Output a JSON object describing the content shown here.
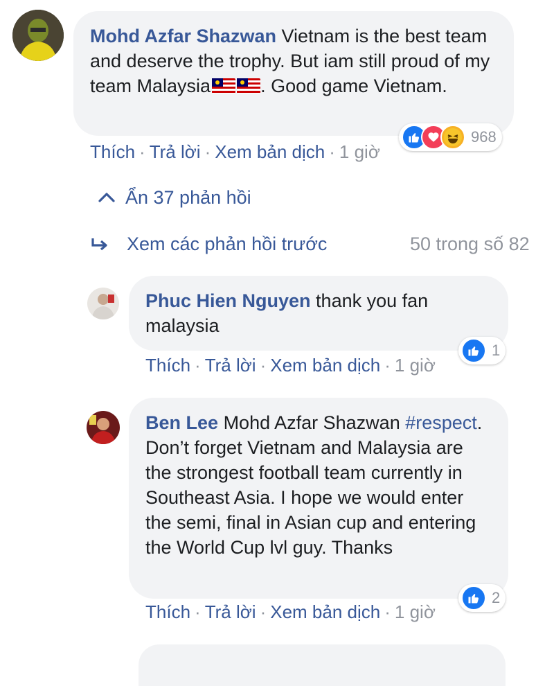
{
  "comments": [
    {
      "author": "Mohd Azfar Shazwan",
      "text_before_flags": "Vietnam is the best team and deserve the trophy. But iam still proud of my team Malaysia",
      "flag_emoji": "🇲🇾",
      "text_after_flags": ". Good game Vietnam.",
      "actions": {
        "like": "Thích",
        "reply": "Trả lời",
        "translate": "Xem bản dịch",
        "time": "1 giờ"
      },
      "reaction_count": "968",
      "reactions": [
        "like-icon",
        "love-icon",
        "haha-icon"
      ]
    },
    {
      "author": "Phuc Hien Nguyen",
      "text": "thank you fan malaysia",
      "actions": {
        "like": "Thích",
        "reply": "Trả lời",
        "translate": "Xem bản dịch",
        "time": "1 giờ"
      },
      "reaction_count": "1",
      "reactions": [
        "like-icon"
      ]
    },
    {
      "author": "Ben Lee",
      "mention": "Mohd Azfar Shazwan",
      "hashtag": "#respect",
      "text": ". Don’t forget Vietnam and Malaysia are the strongest football team currently in Southeast Asia. I hope we would enter the semi, final in Asian cup and entering the World Cup lvl guy. Thanks",
      "actions": {
        "like": "Thích",
        "reply": "Trả lời",
        "translate": "Xem bản dịch",
        "time": "1 giờ"
      },
      "reaction_count": "2",
      "reactions": [
        "like-icon"
      ]
    }
  ],
  "hide_replies": "Ẩn 37 phản hồi",
  "view_previous_replies": "Xem các phản hồi trước",
  "reply_counter": "50 trong số 82",
  "colors": {
    "link": "#385898",
    "muted": "#90949c",
    "bubble": "#f2f3f5",
    "like": "#1877f2",
    "love": "#f33e58",
    "haha": "#f7b125"
  }
}
